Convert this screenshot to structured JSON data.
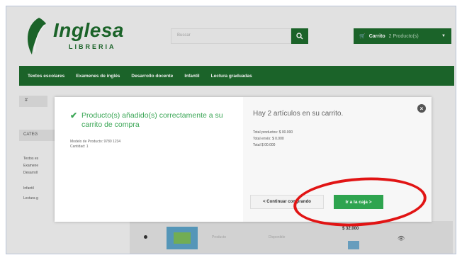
{
  "header": {
    "logo_name": "Inglesa",
    "logo_sub": "LIBRERIA",
    "search_placeholder": "Buscar",
    "cart_label": "Carrito",
    "cart_qty": "2 Producto(s)"
  },
  "nav": [
    "Textos escolares",
    "Examenes de inglés",
    "Desarrollo docente",
    "Infantil",
    "Lectura graduadas"
  ],
  "left": {
    "tab": "#",
    "category": "CATEG",
    "links": [
      "Textos es",
      "Examene",
      "Desarroll",
      "Infantil",
      "Lectura g"
    ]
  },
  "modal": {
    "success_message": "Producto(s) añadido(s) correctamente a su carrito de compra",
    "product_info": [
      "Modelo de Producto: 9780 1234",
      "Cantidad: 1"
    ],
    "cart_title": "Hay 2 artículos en su carrito.",
    "totals": [
      "Total productos: $ 00.000",
      "Total envío: $ 0.000",
      "Total $ 00.000"
    ],
    "continue_label": "< Continuar comprando",
    "checkout_label": "Ir a la caja >",
    "close_icon": "close-icon"
  },
  "bottom_row": {
    "price": "$ 32.000",
    "text1": "Producto",
    "text2": "Disponible"
  },
  "colors": {
    "brand_green": "#1d6a2c",
    "button_green": "#2ea44f",
    "annotation_red": "#e11414"
  }
}
